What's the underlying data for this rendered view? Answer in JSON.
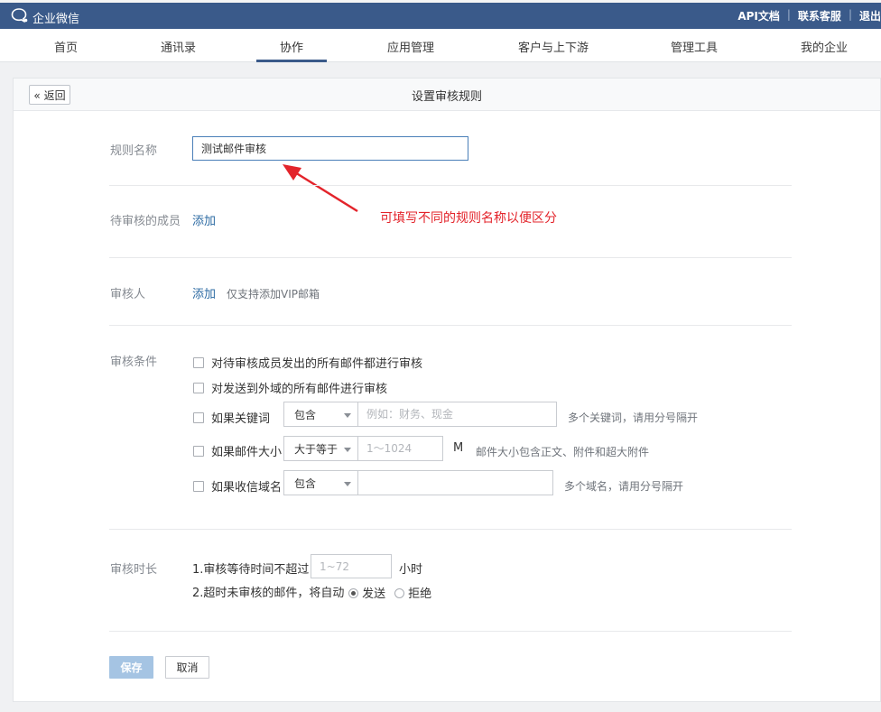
{
  "topbar": {
    "brand": "企业微信",
    "links": [
      "API文档",
      "联系客服",
      "退出"
    ]
  },
  "nav": {
    "tabs": [
      "首页",
      "通讯录",
      "协作",
      "应用管理",
      "客户与上下游",
      "管理工具",
      "我的企业"
    ],
    "active": "协作"
  },
  "page": {
    "back_label": "« 返回",
    "title": "设置审核规则"
  },
  "form": {
    "rule_name": {
      "label": "规则名称",
      "value": "测试邮件审核"
    },
    "members": {
      "label": "待审核的成员",
      "add_label": "添加"
    },
    "reviewer": {
      "label": "审核人",
      "add_label": "添加",
      "hint": "仅支持添加VIP邮箱"
    },
    "conditions": {
      "label": "审核条件",
      "all_outgoing": "对待审核成员发出的所有邮件都进行审核",
      "external": "对发送到外域的所有邮件进行审核",
      "keyword": {
        "label": "如果关键词",
        "select": "包含",
        "placeholder": "例如：财务、现金",
        "hint": "多个关键词，请用分号隔开"
      },
      "size": {
        "label": "如果邮件大小",
        "select": "大于等于",
        "placeholder": "1～1024",
        "unit": "M",
        "hint": "邮件大小包含正文、附件和超大附件"
      },
      "domain": {
        "label": "如果收信域名",
        "select": "包含",
        "placeholder": "",
        "hint": "多个域名，请用分号隔开"
      }
    },
    "duration": {
      "label": "审核时长",
      "line1_prefix": "1.审核等待时间不超过",
      "hours_placeholder": "1~72",
      "hours_unit": "小时",
      "line2_prefix": "2.超时未审核的邮件，将自动",
      "option_send": "发送",
      "option_reject": "拒绝",
      "selected": "发送"
    }
  },
  "annotation": {
    "text": "可填写不同的规则名称以便区分",
    "color": "#e3242b"
  },
  "actions": {
    "save": "保存",
    "cancel": "取消"
  },
  "colors": {
    "header": "#3a5a8a",
    "link": "#2d6ba3",
    "save_disabled": "#a5c4e3"
  }
}
